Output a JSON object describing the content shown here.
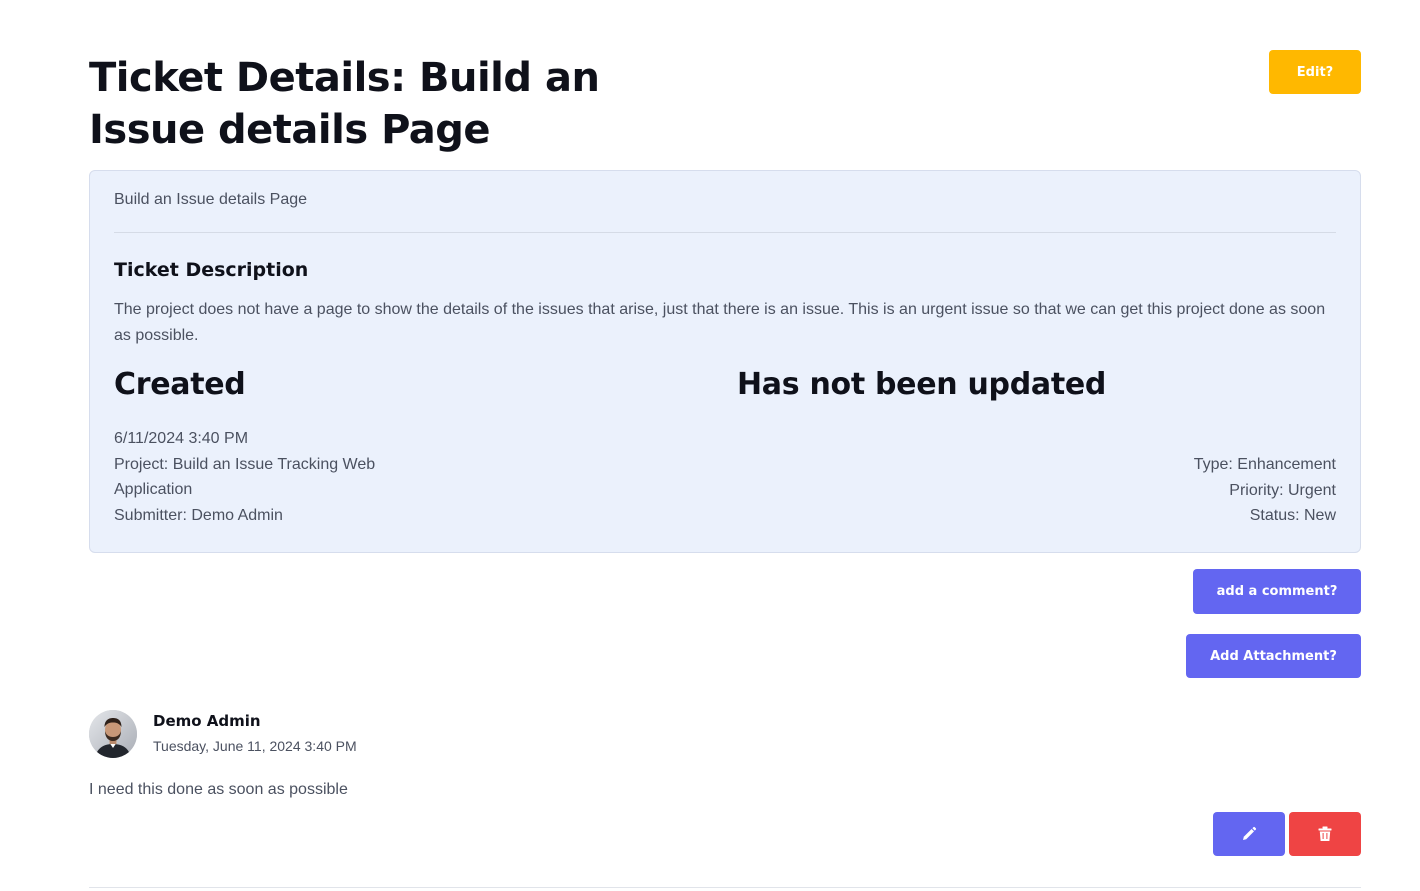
{
  "page": {
    "title": "Ticket Details: Build an Issue details Page",
    "edit_button_label": "Edit?"
  },
  "ticket": {
    "subtitle": "Build an Issue details Page",
    "description_heading": "Ticket Description",
    "description": "The project does not have a page to show the details of the issues that arise, just that there is an issue. This is an urgent issue so that we can get this project done as soon as possible.",
    "created_heading": "Created",
    "updated_heading": "Has not been updated",
    "created_date": "6/11/2024 3:40 PM",
    "project": "Project: Build an Issue Tracking Web Application",
    "submitter": "Submitter: Demo Admin",
    "type": "Type: Enhancement",
    "priority": "Priority: Urgent",
    "status": "Status: New"
  },
  "actions": {
    "add_comment_label": "add a comment?",
    "add_attachment_label": "Add Attachment?"
  },
  "comment": {
    "author": "Demo Admin",
    "date": "Tuesday, June 11, 2024 3:40 PM",
    "text": "I need this done as soon as possible",
    "edit_icon": "pencil-icon",
    "delete_icon": "trash-icon"
  },
  "colors": {
    "edit_button": "#ffb800",
    "primary_button": "#6366f1",
    "danger_button": "#ef4444",
    "card_background": "#ebf1fc"
  }
}
